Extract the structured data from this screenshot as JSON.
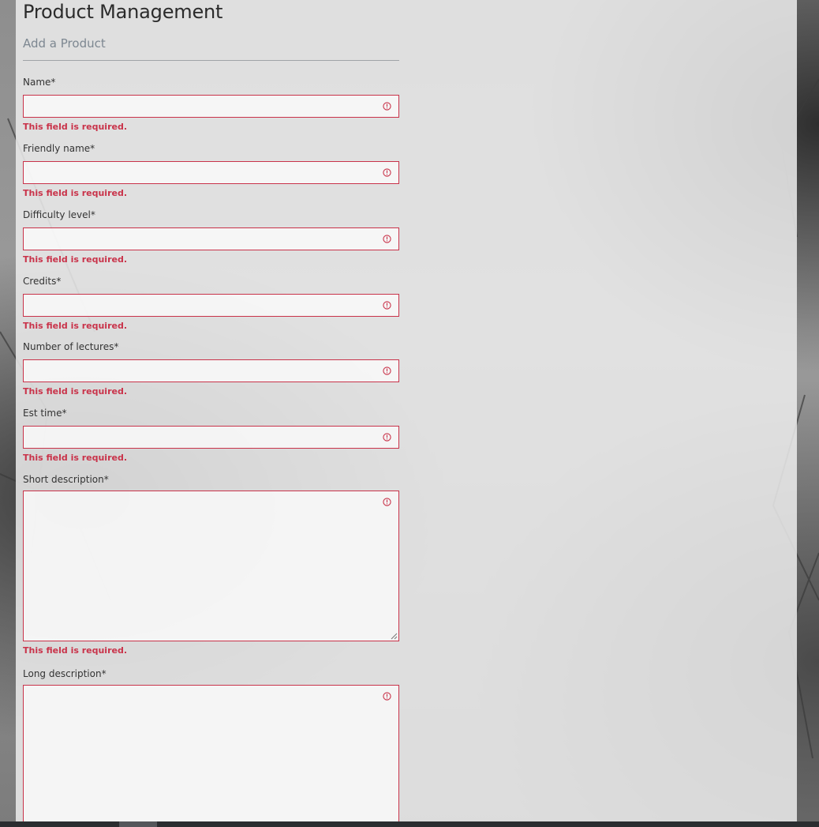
{
  "page": {
    "title": "Product Management",
    "subtitle": "Add a Product"
  },
  "form": {
    "fields": [
      {
        "label": "Name*",
        "value": "",
        "error": "This field is required."
      },
      {
        "label": "Friendly name*",
        "value": "",
        "error": "This field is required."
      },
      {
        "label": "Difficulty level*",
        "value": "",
        "error": "This field is required."
      },
      {
        "label": "Credits*",
        "value": "",
        "error": "This field is required."
      },
      {
        "label": "Number of lectures*",
        "value": "",
        "error": "This field is required."
      },
      {
        "label": "Est time*",
        "value": "",
        "error": "This field is required."
      },
      {
        "label": "Short description*",
        "value": "",
        "error": "This field is required."
      },
      {
        "label": "Long description*",
        "value": ""
      }
    ]
  },
  "icons": {
    "error": "exclamation-circle-icon",
    "resize": "resize-grip-icon"
  },
  "colors": {
    "error": "#c9334a",
    "title": "#2b2b2b",
    "subtitle": "#7d8791"
  }
}
